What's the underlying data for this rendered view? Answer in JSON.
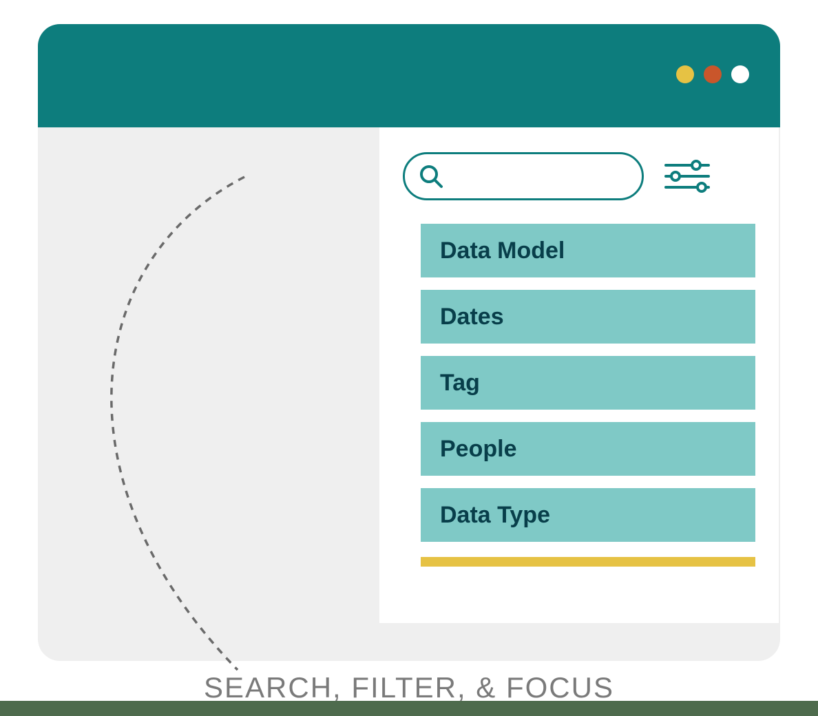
{
  "window": {
    "controls": [
      "yellow",
      "orange",
      "white"
    ]
  },
  "search": {
    "placeholder": "",
    "value": ""
  },
  "filters": {
    "items": [
      {
        "label": "Data Model"
      },
      {
        "label": "Dates"
      },
      {
        "label": "Tag"
      },
      {
        "label": "People"
      },
      {
        "label": "Data Type"
      }
    ]
  },
  "caption": "SEARCH, FILTER, & FOCUS",
  "colors": {
    "primary": "#0d7d7d",
    "filterBg": "#7fc9c6",
    "accent": "#e6c244",
    "footer": "#4e6b4d"
  }
}
